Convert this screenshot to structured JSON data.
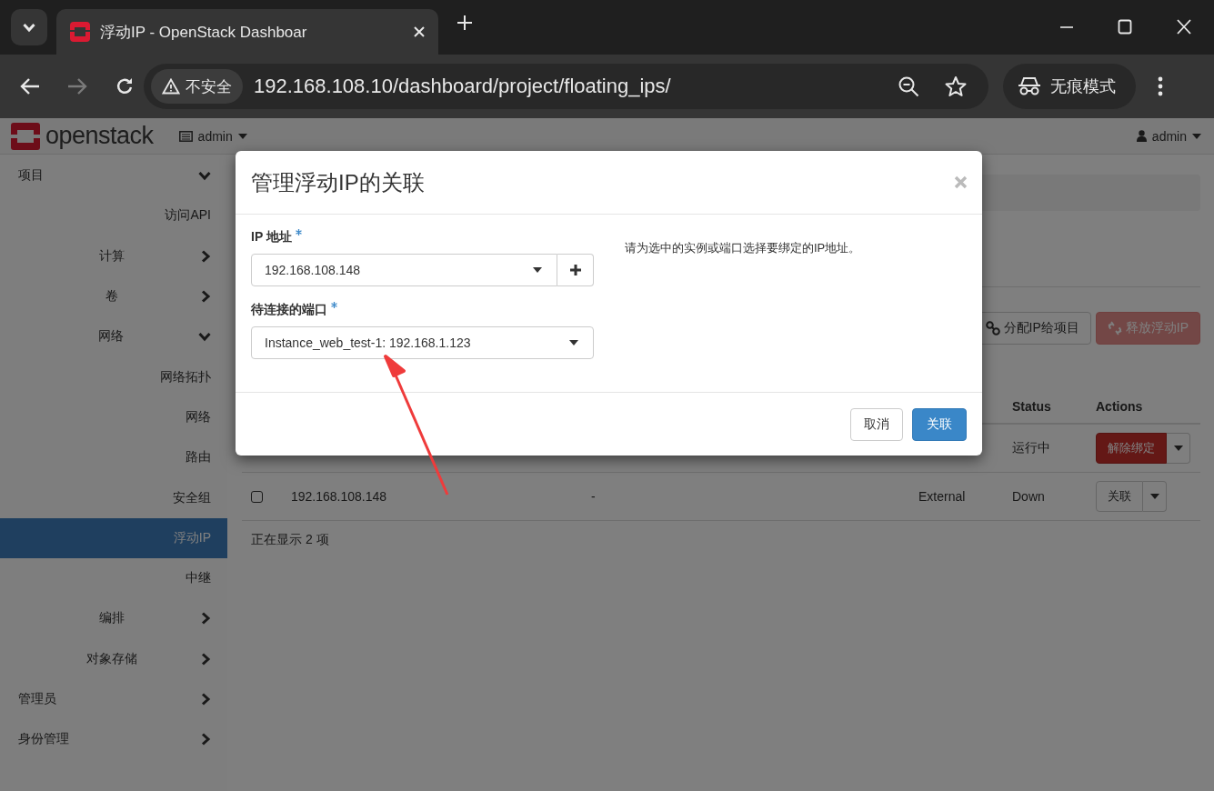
{
  "browser": {
    "tab_title": "浮动IP - OpenStack Dashboar",
    "security_label": "不安全",
    "url": "192.168.108.10/dashboard/project/floating_ips/",
    "incognito_label": "无痕模式"
  },
  "header": {
    "logo": "openstack",
    "project": "admin",
    "user": "admin"
  },
  "sidebar": {
    "items": [
      {
        "label": "项目",
        "kind": "group",
        "expanded": true,
        "children": [
          {
            "label": "访问API",
            "kind": "link",
            "selected": false
          },
          {
            "label": "计算",
            "kind": "group",
            "expanded": false
          },
          {
            "label": "卷",
            "kind": "group",
            "expanded": false
          },
          {
            "label": "网络",
            "kind": "group",
            "expanded": true,
            "children": [
              {
                "label": "网络拓扑",
                "kind": "link",
                "selected": false
              },
              {
                "label": "网络",
                "kind": "link",
                "selected": false
              },
              {
                "label": "路由",
                "kind": "link",
                "selected": false
              },
              {
                "label": "安全组",
                "kind": "link",
                "selected": false
              },
              {
                "label": "浮动IP",
                "kind": "link",
                "selected": true
              },
              {
                "label": "中继",
                "kind": "link",
                "selected": false
              }
            ]
          },
          {
            "label": "编排",
            "kind": "group",
            "expanded": false
          },
          {
            "label": "对象存储",
            "kind": "group",
            "expanded": false
          }
        ]
      },
      {
        "label": "管理员",
        "kind": "group",
        "expanded": false
      },
      {
        "label": "身份管理",
        "kind": "group",
        "expanded": false
      }
    ]
  },
  "toolbar": {
    "buttons": [
      {
        "label": "分配IP给项目",
        "kind": "default",
        "disabled": false
      },
      {
        "label": "释放浮动IP",
        "kind": "danger",
        "disabled": true
      }
    ]
  },
  "table": {
    "columns": [
      "Status",
      "Actions"
    ],
    "rows": [
      {
        "status": "运行中",
        "action": {
          "label": "解除绑定",
          "kind": "danger"
        }
      },
      {
        "checked": false,
        "ip_address": "192.168.108.148",
        "column_3": "-",
        "pool": "External",
        "status": "Down",
        "action": {
          "label": "关联",
          "kind": "default"
        }
      }
    ],
    "footer": "正在显示 2 项"
  },
  "modal": {
    "title": "管理浮动IP的关联",
    "fields": [
      {
        "label": "IP 地址",
        "required": true,
        "value": "192.168.108.148",
        "kind": "select-add"
      },
      {
        "label": "待连接的端口",
        "required": true,
        "value": "Instance_web_test-1: 192.168.1.123",
        "kind": "select"
      }
    ],
    "help": "请为选中的实例或端口选择要绑定的IP地址。",
    "buttons": [
      {
        "label": "取消",
        "kind": "default"
      },
      {
        "label": "关联",
        "kind": "primary"
      }
    ]
  }
}
